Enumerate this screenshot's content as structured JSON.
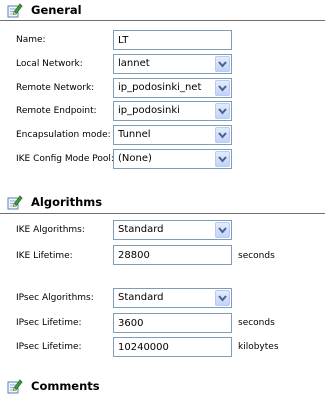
{
  "general": {
    "title": "General",
    "name_label": "Name:",
    "name_value": "LT",
    "local_network_label": "Local Network:",
    "local_network_value": "lannet",
    "remote_network_label": "Remote Network:",
    "remote_network_value": "ip_podosinki_net",
    "remote_endpoint_label": "Remote Endpoint:",
    "remote_endpoint_value": "ip_podosinki",
    "encapsulation_label": "Encapsulation mode:",
    "encapsulation_value": "Tunnel",
    "ike_pool_label": "IKE Config Mode Pool:",
    "ike_pool_value": "(None)"
  },
  "algorithms": {
    "title": "Algorithms",
    "ike_algorithms_label": "IKE Algorithms:",
    "ike_algorithms_value": "Standard",
    "ike_lifetime_label": "IKE Lifetime:",
    "ike_lifetime_value": "28800",
    "ike_lifetime_unit": "seconds",
    "ipsec_algorithms_label": "IPsec Algorithms:",
    "ipsec_algorithms_value": "Standard",
    "ipsec_lifetime_seconds_label": "IPsec Lifetime:",
    "ipsec_lifetime_seconds_value": "3600",
    "ipsec_lifetime_seconds_unit": "seconds",
    "ipsec_lifetime_kb_label": "IPsec Lifetime:",
    "ipsec_lifetime_kb_value": "10240000",
    "ipsec_lifetime_kb_unit": "kilobytes"
  },
  "comments": {
    "title": "Comments"
  },
  "icons": {
    "section_icon": "edit-note-icon",
    "dropdown_icon": "chevron-down-icon"
  },
  "colors": {
    "field_border": "#7f9db9",
    "dropdown_button": "#c1d3fb",
    "dropdown_arrow": "#4d6185",
    "rule": "#6f6f6f"
  }
}
